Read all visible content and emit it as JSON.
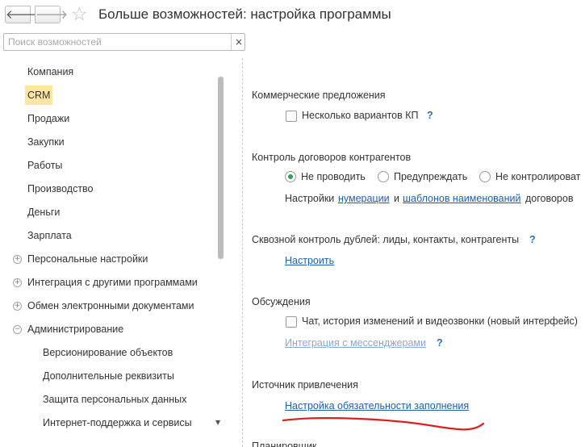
{
  "window": {
    "title": "Больше возможностей: настройка программы",
    "back_glyph": "🡐",
    "forward_glyph": "🡒",
    "star_glyph": "☆"
  },
  "search": {
    "placeholder": "Поиск возможностей",
    "value": "",
    "clear_glyph": "×"
  },
  "sidebar": {
    "items": [
      {
        "label": "Компания"
      },
      {
        "label": "CRM"
      },
      {
        "label": "Продажи"
      },
      {
        "label": "Закупки"
      },
      {
        "label": "Работы"
      },
      {
        "label": "Производство"
      },
      {
        "label": "Деньги"
      },
      {
        "label": "Зарплата"
      },
      {
        "label": "Персональные настройки"
      },
      {
        "label": "Интеграция с другими программами"
      },
      {
        "label": "Обмен электронными документами"
      },
      {
        "label": "Администрирование"
      },
      {
        "label": "Версионирование объектов"
      },
      {
        "label": "Дополнительные реквизиты"
      },
      {
        "label": "Защита персональных данных"
      },
      {
        "label": "Интернет-поддержка и сервисы"
      }
    ],
    "expand_glyph": "+",
    "collapse_glyph": "−",
    "scroll_down_glyph": "▼",
    "active_color": "#fce6a1"
  },
  "content": {
    "top_cut_text": "' ' ' ' '",
    "commercial": {
      "heading": "Коммерческие предложения",
      "checkbox_label": "Несколько вариантов КП",
      "help": "?"
    },
    "contracts": {
      "heading": "Контроль договоров контрагентов",
      "options": [
        "Не проводить",
        "Предупреждать",
        "Не контролировать"
      ],
      "selected": "Не проводить",
      "settings_prefix": "Настройки",
      "link_numbering": "нумерации",
      "and_text": "и",
      "link_templates": "шаблонов наименований",
      "settings_suffix": "договоров"
    },
    "duplicates": {
      "heading": "Сквозной контроль дублей: лиды, контакты, контрагенты",
      "help": "?",
      "link": "Настроить"
    },
    "discussions": {
      "heading": "Обсуждения",
      "checkbox_label": "Чат, история изменений и видеозвонки (новый интерфейс)",
      "link": "Интеграция с мессенджерами",
      "help": "?"
    },
    "source": {
      "heading": "Источник привлечения",
      "link": "Настройка обязательности заполнения"
    },
    "bottom_cut": "Планировщик"
  },
  "colors": {
    "link": "#1f5fa8",
    "help": "#2b6fb5",
    "radio_selected": "#2e9e58",
    "annotation": "#d92020"
  }
}
